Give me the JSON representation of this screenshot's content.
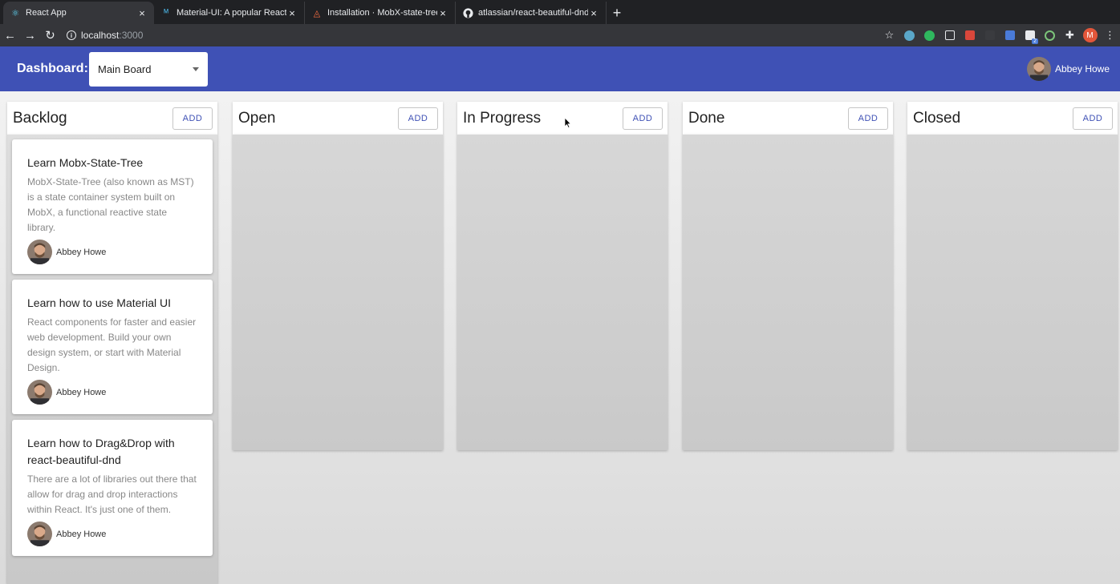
{
  "browser": {
    "tabs": [
      {
        "title": "React App",
        "icon": "react-icon",
        "active": true
      },
      {
        "title": "Material-UI: A popular React UI",
        "icon": "material-ui-icon",
        "active": false
      },
      {
        "title": "Installation · MobX-state-tree",
        "icon": "mobx-icon",
        "active": false
      },
      {
        "title": "atlassian/react-beautiful-dnd:",
        "icon": "github-icon",
        "active": false
      }
    ],
    "url_host": "localhost",
    "url_port": ":3000",
    "profile_initial": "M",
    "ext_badge": "2"
  },
  "appbar": {
    "dashboard_label": "Dashboard:",
    "board_selected": "Main Board",
    "user_name": "Abbey Howe"
  },
  "columns": [
    {
      "title": "Backlog",
      "add_label": "ADD"
    },
    {
      "title": "Open",
      "add_label": "ADD"
    },
    {
      "title": "In Progress",
      "add_label": "ADD"
    },
    {
      "title": "Done",
      "add_label": "ADD"
    },
    {
      "title": "Closed",
      "add_label": "ADD"
    }
  ],
  "backlog_cards": [
    {
      "title": "Learn Mobx-State-Tree",
      "description": "MobX-State-Tree (also known as MST) is a state container system built on MobX, a functional reactive state library.",
      "assignee": "Abbey Howe"
    },
    {
      "title": "Learn how to use Material UI",
      "description": "React components for faster and easier web development. Build your own design system, or start with Material Design.",
      "assignee": "Abbey Howe"
    },
    {
      "title": "Learn how to Drag&Drop with react-beautiful-dnd",
      "description": "There are a lot of libraries out there that allow for drag and drop interactions within React. It's just one of them.",
      "assignee": "Abbey Howe"
    }
  ],
  "colors": {
    "primary": "#3f51b5",
    "chrome_dark": "#202124",
    "chrome_mid": "#35363a"
  }
}
